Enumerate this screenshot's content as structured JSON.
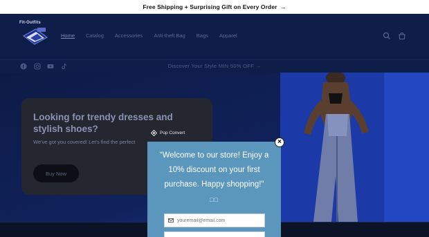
{
  "announcement": {
    "text": "Free Shipping + Surprising Gift on Every Order",
    "arrow": "→"
  },
  "header": {
    "logo_text": "Fit-Outfits",
    "nav": [
      "Home",
      "Catalog",
      "Accessories",
      "Anti-theft Bag",
      "Bags",
      "Apparel"
    ],
    "icons": [
      "search-icon",
      "cart-icon"
    ]
  },
  "social": {
    "icons": [
      "facebook-icon",
      "instagram-icon",
      "youtube-icon",
      "tiktok-icon"
    ],
    "promo": "Discover Your Style MIN 50% OFF",
    "promo_arrow": "→"
  },
  "hero": {
    "heading": "Looking for trendy dresses and stylish shoes?",
    "subtext": "We've got you covered! Let's find the perfect",
    "button": "Buy Now"
  },
  "popup": {
    "brand": "Pop Convert",
    "close": "×",
    "message": "\"Welcome to our store! Enjoy a 10% discount on your first purchase. Happy shopping!\"",
    "glyph": "□□",
    "email_placeholder": "youremail@email.com"
  },
  "colors": {
    "header_bg": "#0f1d49",
    "popup_bg": "#5b96bc",
    "card_bg": "#24272f"
  }
}
